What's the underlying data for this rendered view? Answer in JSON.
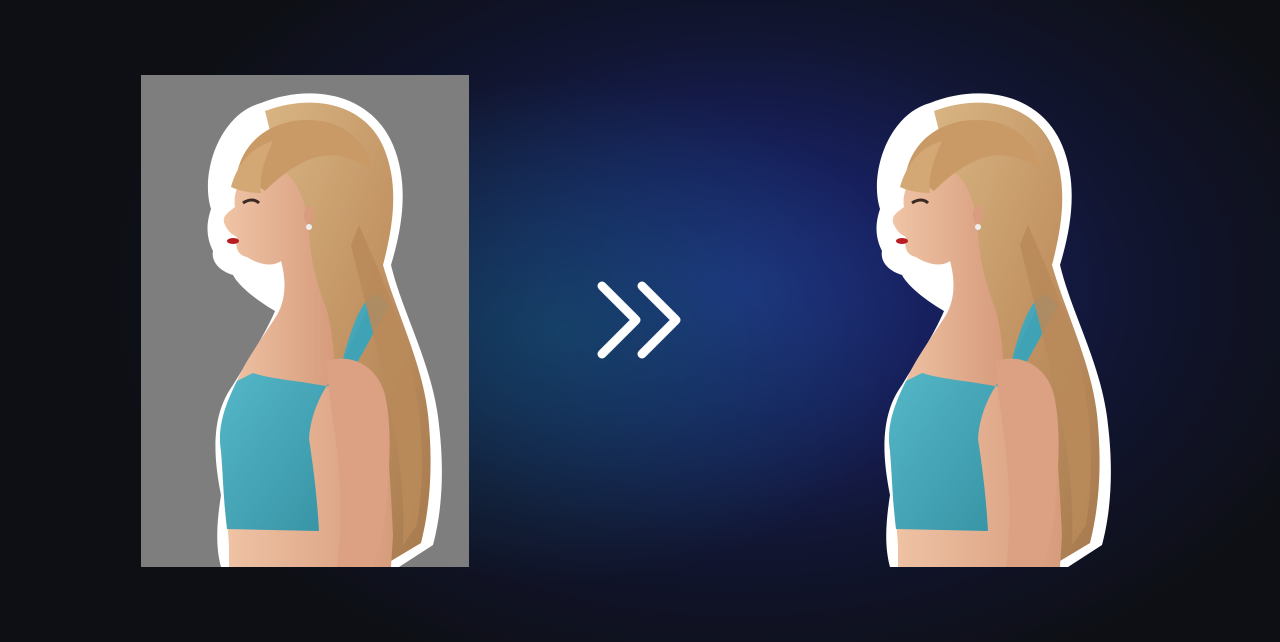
{
  "comparison": {
    "before": {
      "subject": "person-portrait-icon",
      "background_color": "#7e7e7e"
    },
    "after": {
      "subject": "person-portrait-icon",
      "background_color": "transparent"
    },
    "arrow_icon": "double-chevron-right-icon",
    "arrow_color": "#ffffff"
  },
  "palette": {
    "hair": "#c79d6b",
    "skin": "#e5b296",
    "top": "#3fa3b5",
    "lips": "#b81d24",
    "outline": "#ffffff"
  }
}
